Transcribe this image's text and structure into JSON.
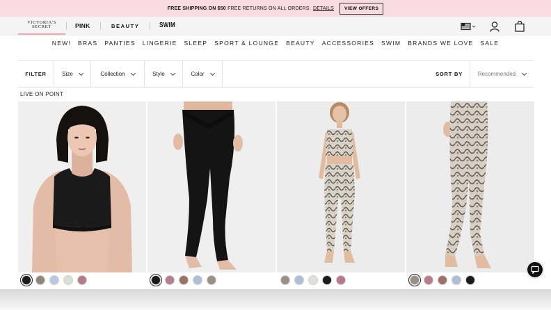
{
  "promo": {
    "free_shipping": "FREE SHIPPING ON $50",
    "free_returns": "FREE RETURNS ON ALL ORDERS",
    "details_link": "DETAILS",
    "view_offers_button": "VIEW OFFERS"
  },
  "brands": {
    "victorias_line1": "VICTORIA'S",
    "victorias_line2": "SECRET",
    "pink": "PINK",
    "beauty": "BEAUTY",
    "swim": "SWIM"
  },
  "header_icons": [
    "flag-selector-icon",
    "account-icon",
    "shopping-bag-icon"
  ],
  "nav": {
    "items": [
      "NEW!",
      "BRAS",
      "PANTIES",
      "LINGERIE",
      "SLEEP",
      "SPORT & LOUNGE",
      "BEAUTY",
      "ACCESSORIES",
      "SWIM",
      "BRANDS WE LOVE",
      "SALE"
    ]
  },
  "filters": {
    "title": "FILTER",
    "options": [
      "Size",
      "Collection",
      "Style",
      "Color"
    ],
    "sort_label": "SORT BY",
    "sort_value": "Recommended"
  },
  "collection_label": "LIVE ON POINT",
  "products": [
    {
      "image": "woman-black-sports-bra",
      "swatches": [
        "#1b1b1b",
        "#8f8679",
        "#b9c9df",
        "#d8e0da",
        "#b77a8a"
      ],
      "selected_swatch": 0
    },
    {
      "image": "black-high-waist-leggings",
      "swatches": [
        "#1b1b1b",
        "#b47e8c",
        "#9b7168",
        "#aebed6",
        "#9a8f84"
      ],
      "selected_swatch": 0
    },
    {
      "image": "snakeskin-print-set",
      "swatches": [
        "#9a8f84",
        "#aebfdb",
        "#dce2dc",
        "#1b1b1b",
        "#b77a8a"
      ],
      "selected_swatch": null
    },
    {
      "image": "snakeskin-print-leggings",
      "swatches": [
        "#9a8f84",
        "#b47e8c",
        "#9b7168",
        "#aebed6",
        "#1b1b1b"
      ],
      "selected_swatch": 0
    }
  ],
  "chat_icon": "chat-bubble-icon",
  "colors": {
    "promo_bg": "#f8dbe2",
    "brand_underline": "#e8a8b5"
  }
}
